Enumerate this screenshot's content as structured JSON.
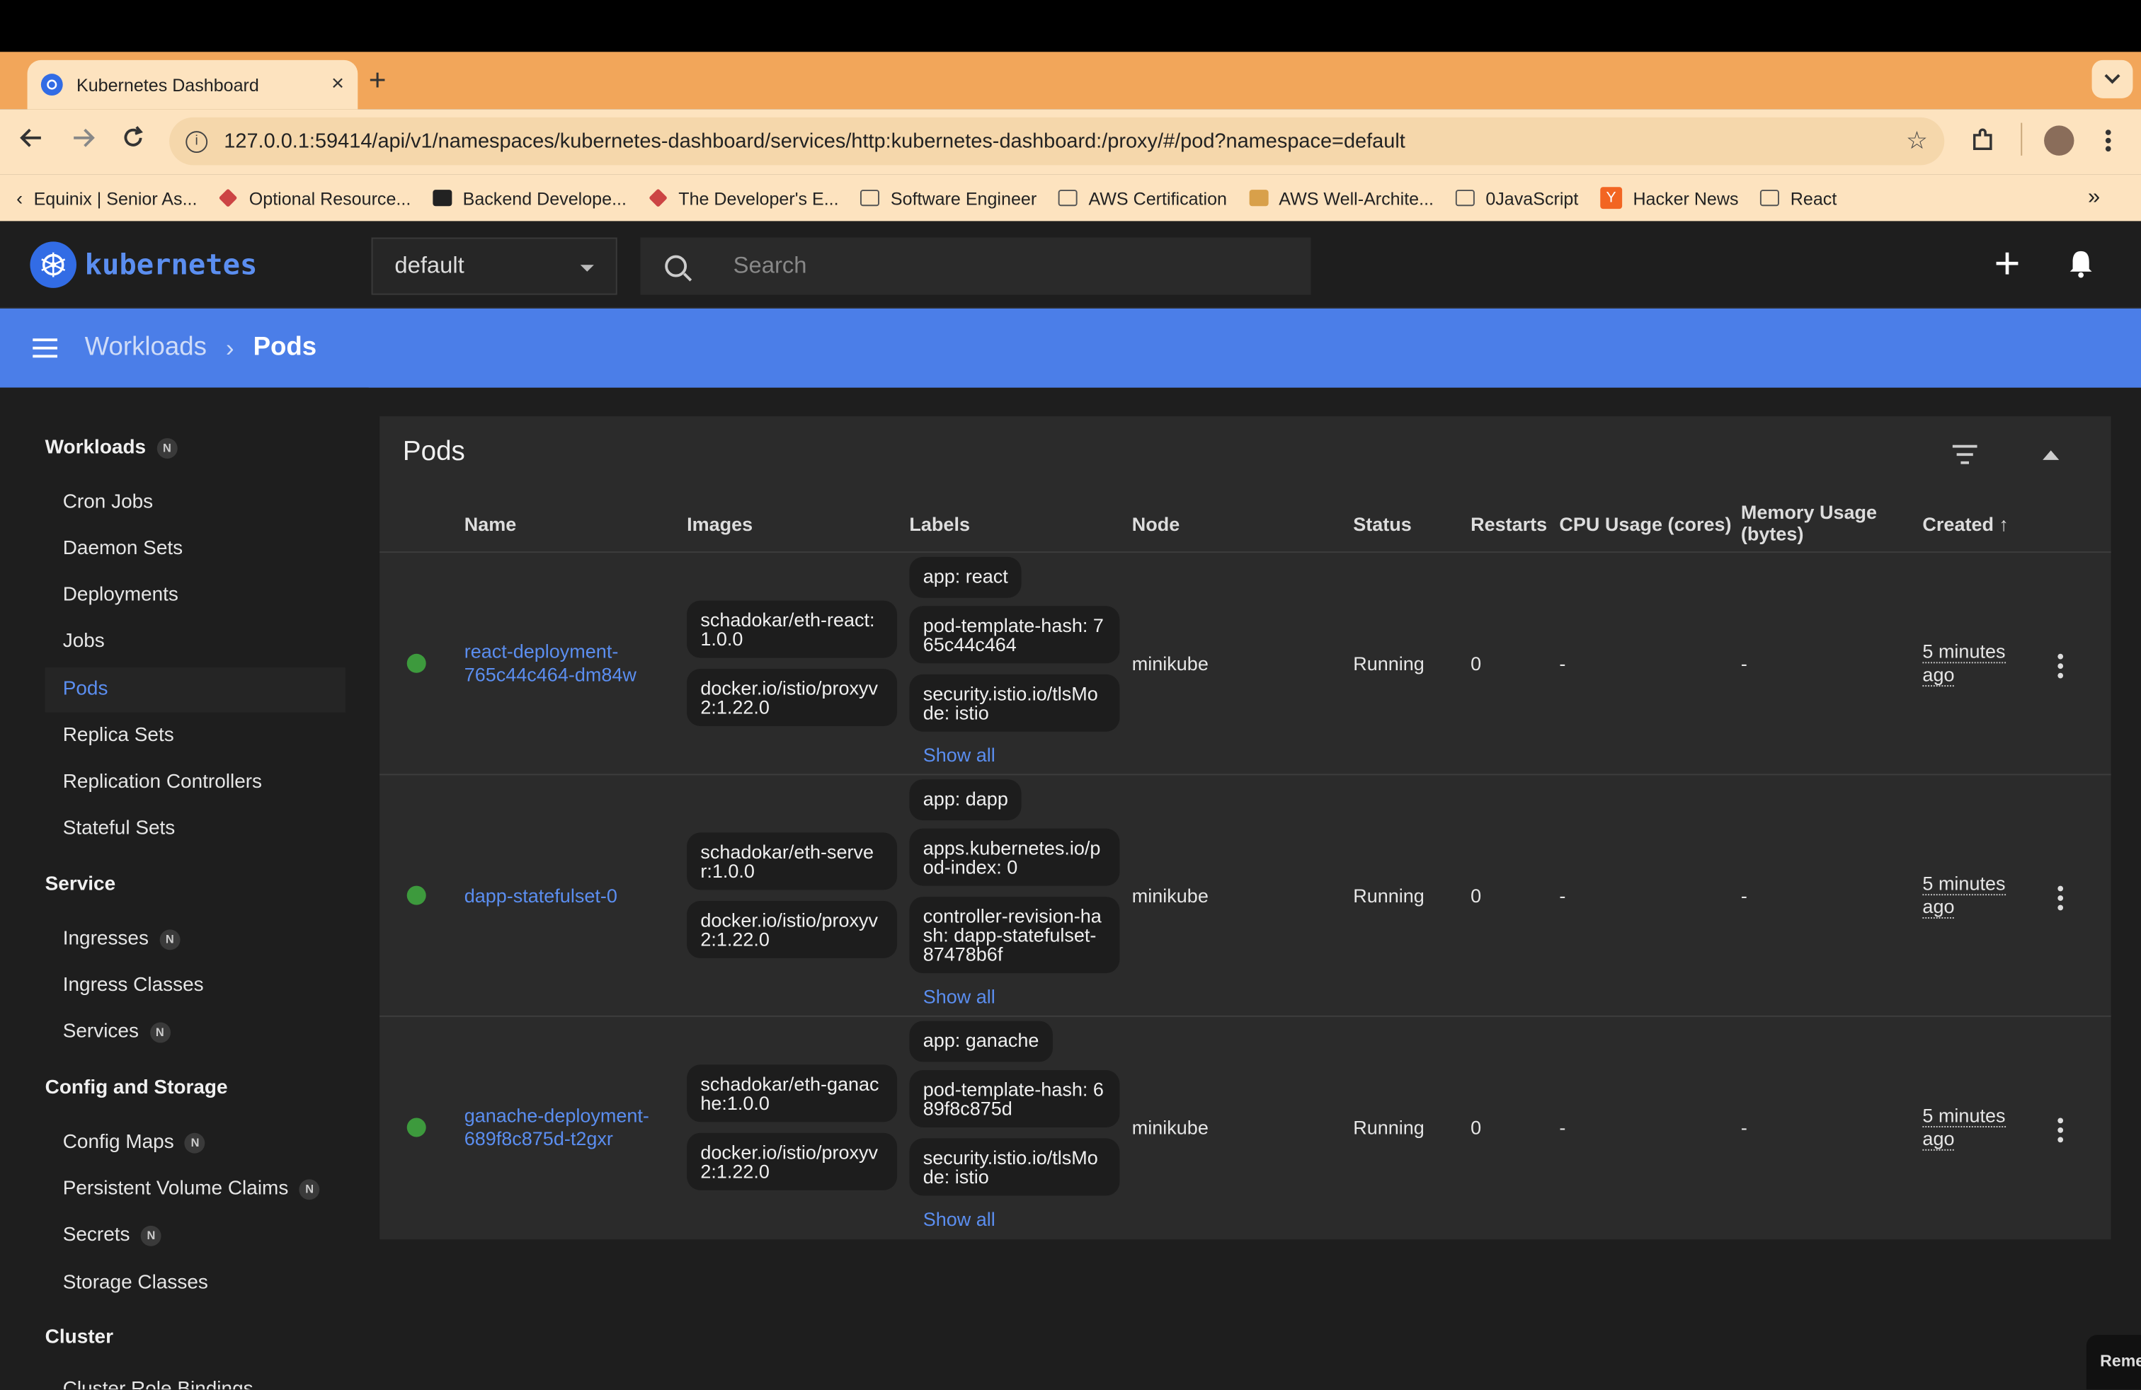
{
  "browser": {
    "tab_title": "Kubernetes Dashboard",
    "tab_close": "×",
    "new_tab": "+",
    "url": "127.0.0.1:59414/api/v1/namespaces/kubernetes-dashboard/services/http:kubernetes-dashboard:/proxy/#/pod?namespace=default",
    "bookmarks": [
      {
        "label": "Equinix | Senior As...",
        "icon": "chevron-left-icon"
      },
      {
        "label": "Optional Resource...",
        "icon": "site-icon"
      },
      {
        "label": "Backend Develope...",
        "icon": "site-icon"
      },
      {
        "label": "The Developer's E...",
        "icon": "site-icon"
      },
      {
        "label": "Software Engineer",
        "icon": "folder-icon"
      },
      {
        "label": "AWS Certification",
        "icon": "folder-icon"
      },
      {
        "label": "AWS Well-Archite...",
        "icon": "site-icon"
      },
      {
        "label": "0JavaScript",
        "icon": "folder-icon"
      },
      {
        "label": "Hacker News",
        "icon": "hacker-news-icon"
      },
      {
        "label": "React",
        "icon": "folder-icon"
      }
    ],
    "bookmarks_overflow": "»"
  },
  "header": {
    "brand": "kubernetes",
    "namespace": "default",
    "search_placeholder": "Search"
  },
  "breadcrumb": {
    "parent": "Workloads",
    "current": "Pods"
  },
  "sidebar": {
    "badge": "N",
    "workloads_title": "Workloads",
    "workloads": [
      "Cron Jobs",
      "Daemon Sets",
      "Deployments",
      "Jobs",
      "Pods",
      "Replica Sets",
      "Replication Controllers",
      "Stateful Sets"
    ],
    "service_title": "Service",
    "service": [
      "Ingresses",
      "Ingress Classes",
      "Services"
    ],
    "config_title": "Config and Storage",
    "config": [
      "Config Maps",
      "Persistent Volume Claims",
      "Secrets",
      "Storage Classes"
    ],
    "cluster_title": "Cluster",
    "cluster_first": "Cluster Role Bindings"
  },
  "pods": {
    "title": "Pods",
    "columns": {
      "name": "Name",
      "images": "Images",
      "labels": "Labels",
      "node": "Node",
      "status": "Status",
      "restarts": "Restarts",
      "cpu": "CPU Usage (cores)",
      "memory": "Memory Usage (bytes)",
      "created": "Created"
    },
    "sort_arrow": "↑",
    "show_all": "Show all",
    "rows": [
      {
        "name": "react-deployment-765c44c464-dm84w",
        "images": [
          "schadokar/eth-react:1.0.0",
          "docker.io/istio/proxyv2:1.22.0"
        ],
        "labels": [
          "app: react",
          "pod-template-hash: 765c44c464",
          "security.istio.io/tlsMode: istio"
        ],
        "node": "minikube",
        "status": "Running",
        "restarts": "0",
        "cpu": "-",
        "memory": "-",
        "created": "5 minutes ago"
      },
      {
        "name": "dapp-statefulset-0",
        "images": [
          "schadokar/eth-server:1.0.0",
          "docker.io/istio/proxyv2:1.22.0"
        ],
        "labels": [
          "app: dapp",
          "apps.kubernetes.io/pod-index: 0",
          "controller-revision-hash: dapp-statefulset-87478b6f"
        ],
        "node": "minikube",
        "status": "Running",
        "restarts": "0",
        "cpu": "-",
        "memory": "-",
        "created": "5 minutes ago"
      },
      {
        "name": "ganache-deployment-689f8c875d-t2gxr",
        "images": [
          "schadokar/eth-ganache:1.0.0",
          "docker.io/istio/proxyv2:1.22.0"
        ],
        "labels": [
          "app: ganache",
          "pod-template-hash: 689f8c875d",
          "security.istio.io/tlsMode: istio"
        ],
        "node": "minikube",
        "status": "Running",
        "restarts": "0",
        "cpu": "-",
        "memory": "-",
        "created": "5 minutes ago"
      }
    ]
  },
  "corner_popup": "Reme"
}
